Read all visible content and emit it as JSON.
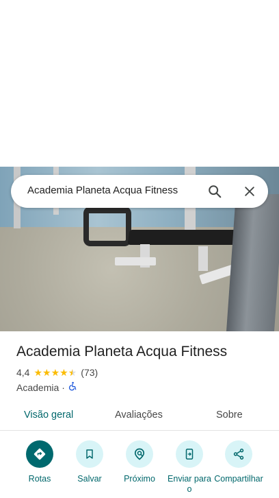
{
  "search": {
    "query": "Academia Planeta Acqua Fitness"
  },
  "place": {
    "name": "Academia Planeta Acqua Fitness",
    "rating": "4,4",
    "rating_value": 4.4,
    "review_count": "(73)",
    "category": "Academia",
    "separator": "·",
    "accessibility_icon": "wheelchair-icon"
  },
  "tabs": [
    {
      "label": "Visão geral",
      "active": true
    },
    {
      "label": "Avaliações",
      "active": false
    },
    {
      "label": "Sobre",
      "active": false
    }
  ],
  "actions": [
    {
      "label": "Rotas",
      "icon": "directions-icon"
    },
    {
      "label": "Salvar",
      "icon": "bookmark-icon"
    },
    {
      "label": "Próximo",
      "icon": "nearby-icon"
    },
    {
      "label": "Enviar para o",
      "icon": "send-to-phone-icon"
    },
    {
      "label": "Compartilhar",
      "icon": "share-icon"
    }
  ],
  "colors": {
    "accent": "#00676b",
    "action_bg": "#d8f4f7",
    "star": "#fbbc04"
  }
}
